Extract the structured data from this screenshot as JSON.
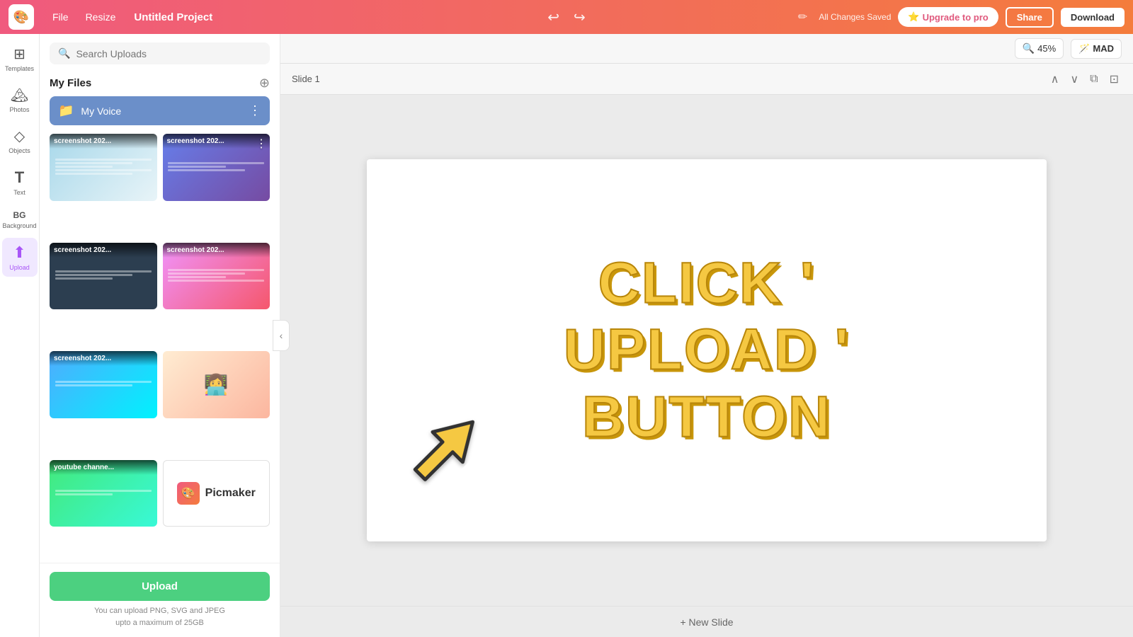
{
  "topbar": {
    "logo": "🎨",
    "file_label": "File",
    "resize_label": "Resize",
    "project_title": "Untitled Project",
    "saved_status": "All Changes Saved",
    "upgrade_label": "Upgrade to pro",
    "share_label": "Share",
    "download_label": "Download"
  },
  "sidebar": {
    "items": [
      {
        "id": "templates",
        "label": "Templates",
        "icon": "⊞"
      },
      {
        "id": "photos",
        "label": "Photos",
        "icon": "🏔"
      },
      {
        "id": "objects",
        "label": "Objects",
        "icon": "◇"
      },
      {
        "id": "text",
        "label": "Text",
        "icon": "T"
      },
      {
        "id": "background",
        "label": "Background",
        "icon": "BG"
      },
      {
        "id": "upload",
        "label": "Upload",
        "icon": "↑"
      }
    ]
  },
  "uploads_panel": {
    "search_placeholder": "Search Uploads",
    "my_files_title": "My Files",
    "folder": {
      "name": "My Voice",
      "icon": "📁"
    },
    "thumbnails": [
      {
        "id": 1,
        "label": "screenshot 202...",
        "has_more": false
      },
      {
        "id": 2,
        "label": "screenshot 202...",
        "has_more": true
      },
      {
        "id": 3,
        "label": "screenshot 202...",
        "has_more": false
      },
      {
        "id": 4,
        "label": "screenshot 202...",
        "has_more": false
      },
      {
        "id": 5,
        "label": "screenshot 202...",
        "has_more": false
      },
      {
        "id": 6,
        "label": "",
        "has_more": false
      },
      {
        "id": 7,
        "label": "youtube channe...",
        "has_more": false
      },
      {
        "id": 8,
        "label": "",
        "has_more": false
      }
    ],
    "upload_btn_label": "Upload",
    "upload_hint_line1": "You can upload PNG, SVG and JPEG",
    "upload_hint_line2": "upto a maximum of 25GB"
  },
  "canvas": {
    "slide_title": "Slide 1",
    "zoom_level": "45%",
    "user_badge": "MAD",
    "new_slide_label": "+ New Slide",
    "main_text_line1": "CLICK ' UPLOAD '",
    "main_text_line2": "BUTTON"
  }
}
